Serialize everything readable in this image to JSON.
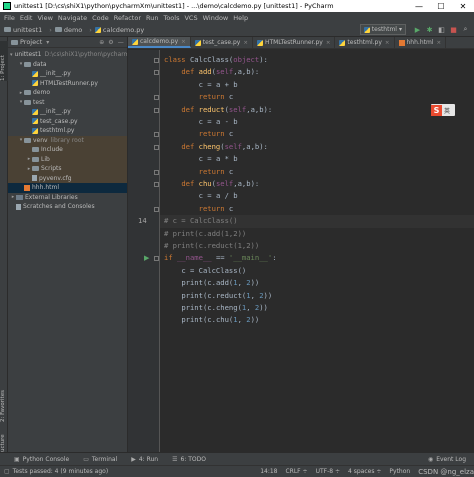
{
  "window": {
    "title": "unittest1 [D:\\cs\\shiX1\\python\\pycharmXm\\unittest1] - ...\\demo\\calcdemo.py [unittest1] - PyCharm",
    "minimize": "—",
    "maximize": "☐",
    "close": "✕"
  },
  "menu": [
    "File",
    "Edit",
    "View",
    "Navigate",
    "Code",
    "Refactor",
    "Run",
    "Tools",
    "VCS",
    "Window",
    "Help"
  ],
  "breadcrumb": [
    "unittest1",
    "demo",
    "calcdemo.py"
  ],
  "toolbar": {
    "run_config": "testhtml"
  },
  "project_panel": {
    "title": "Project",
    "tree": [
      {
        "label": "unittest1",
        "extra": "D:\\cs\\shiX1\\python\\pycharmX",
        "indent": 0,
        "kind": "folder",
        "arrow": "▾"
      },
      {
        "label": "data",
        "extra": "",
        "indent": 1,
        "kind": "folder",
        "arrow": "▾"
      },
      {
        "label": "__init__.py",
        "extra": "",
        "indent": 2,
        "kind": "py",
        "arrow": ""
      },
      {
        "label": "HTMLTestRunner.py",
        "extra": "",
        "indent": 2,
        "kind": "py",
        "arrow": ""
      },
      {
        "label": "demo",
        "extra": "",
        "indent": 1,
        "kind": "folder",
        "arrow": "▸"
      },
      {
        "label": "test",
        "extra": "",
        "indent": 1,
        "kind": "folder",
        "arrow": "▾"
      },
      {
        "label": "__init__.py",
        "extra": "",
        "indent": 2,
        "kind": "py",
        "arrow": ""
      },
      {
        "label": "test_case.py",
        "extra": "",
        "indent": 2,
        "kind": "py",
        "arrow": ""
      },
      {
        "label": "testhtml.py",
        "extra": "",
        "indent": 2,
        "kind": "py",
        "arrow": ""
      },
      {
        "label": "venv",
        "extra": "library root",
        "indent": 1,
        "kind": "folder",
        "arrow": "▾",
        "venv": true
      },
      {
        "label": "Include",
        "extra": "",
        "indent": 2,
        "kind": "folder",
        "arrow": "",
        "venv": true
      },
      {
        "label": "Lib",
        "extra": "",
        "indent": 2,
        "kind": "folder",
        "arrow": "▸",
        "venv": true
      },
      {
        "label": "Scripts",
        "extra": "",
        "indent": 2,
        "kind": "folder",
        "arrow": "▸",
        "venv": true
      },
      {
        "label": "pyvenv.cfg",
        "extra": "",
        "indent": 2,
        "kind": "file",
        "arrow": "",
        "venv": true
      },
      {
        "label": "hhh.html",
        "extra": "",
        "indent": 1,
        "kind": "html",
        "arrow": "",
        "selected": true
      },
      {
        "label": "External Libraries",
        "extra": "",
        "indent": 0,
        "kind": "lib",
        "arrow": "▸"
      },
      {
        "label": "Scratches and Consoles",
        "extra": "",
        "indent": 0,
        "kind": "scratch",
        "arrow": ""
      }
    ]
  },
  "left_strip": {
    "project": "1: Project",
    "favorites": "2: Favorites",
    "structure": "7: Structure"
  },
  "tabs": [
    {
      "label": "calcdemo.py",
      "kind": "py",
      "active": true
    },
    {
      "label": "test_case.py",
      "kind": "py",
      "active": false
    },
    {
      "label": "HTMLTestRunner.py",
      "kind": "py",
      "active": false
    },
    {
      "label": "testhtml.py",
      "kind": "py",
      "active": false
    },
    {
      "label": "hhh.html",
      "kind": "html",
      "active": false
    }
  ],
  "editor": {
    "current_line": 14,
    "lines": [
      "class CalcClass(object):",
      "    def add(self,a,b):",
      "        c = a + b",
      "        return c",
      "    def reduct(self,a,b):",
      "        c = a - b",
      "        return c",
      "    def cheng(self,a,b):",
      "        c = a * b",
      "        return c",
      "    def chu(self,a,b):",
      "        c = a / b",
      "        return c",
      "# c = CalcClass()",
      "# print(c.add(1,2))",
      "# print(c.reduct(1,2))",
      "if __name__ == '__main__':",
      "    c = CalcClass()",
      "    print(c.add(1, 2))",
      "    print(c.reduct(1, 2))",
      "    print(c.cheng(1, 2))",
      "    print(c.chu(1, 2))"
    ]
  },
  "ime": {
    "logo": "S",
    "mode": "英"
  },
  "bottom_tabs": [
    {
      "label": "Python Console",
      "icon": "▣"
    },
    {
      "label": "Terminal",
      "icon": "▭"
    },
    {
      "label": "4: Run",
      "icon": "▶"
    },
    {
      "label": "6: TODO",
      "icon": "☰"
    }
  ],
  "event_log": "Event Log",
  "status": {
    "message": "Tests passed: 4 (9 minutes ago)",
    "position": "14:18",
    "line_sep": "CRLF ÷",
    "encoding": "UTF-8 ÷",
    "indent": "4 spaces ÷",
    "interpreter": "Python",
    "watermark": "CSDN @ng_elza"
  }
}
